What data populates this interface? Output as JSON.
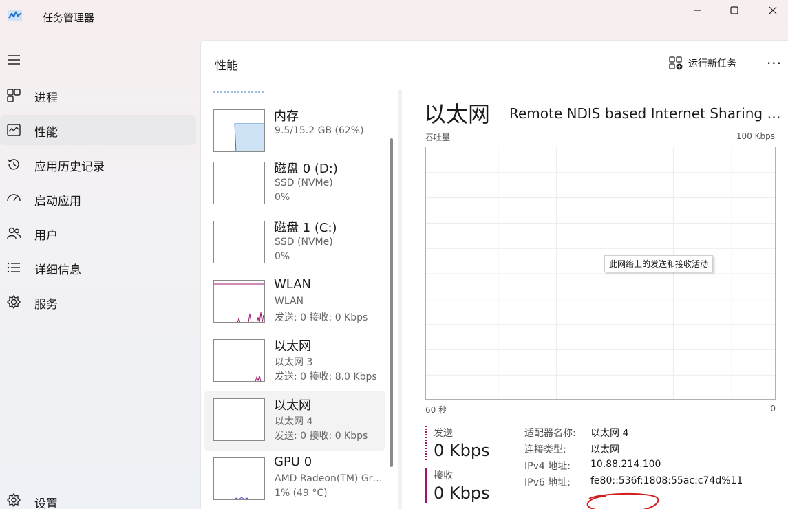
{
  "window": {
    "title": "任务管理器"
  },
  "sidebar": {
    "items": [
      {
        "label": "进程",
        "icon": "processes-icon"
      },
      {
        "label": "性能",
        "icon": "performance-icon",
        "active": true
      },
      {
        "label": "应用历史记录",
        "icon": "app-history-icon"
      },
      {
        "label": "启动应用",
        "icon": "startup-apps-icon"
      },
      {
        "label": "用户",
        "icon": "users-icon"
      },
      {
        "label": "详细信息",
        "icon": "details-icon"
      },
      {
        "label": "服务",
        "icon": "services-icon"
      }
    ],
    "settings_label": "设置"
  },
  "header": {
    "title": "性能",
    "run_task_label": "运行新任务",
    "more_label": "···"
  },
  "devices": [
    {
      "name": "内存",
      "sub1": "9.5/15.2 GB (62%)",
      "sub2": ""
    },
    {
      "name": "磁盘 0 (D:)",
      "sub1": "SSD (NVMe)",
      "sub2": "0%"
    },
    {
      "name": "磁盘 1 (C:)",
      "sub1": "SSD (NVMe)",
      "sub2": "0%"
    },
    {
      "name": "WLAN",
      "sub1": "WLAN",
      "sub2": "发送: 0 接收: 0 Kbps"
    },
    {
      "name": "以太网",
      "sub1": "以太网 3",
      "sub2": "发送: 0 接收: 8.0 Kbps"
    },
    {
      "name": "以太网",
      "sub1": "以太网 4",
      "sub2": "发送: 0 接收: 0 Kbps",
      "active": true
    },
    {
      "name": "GPU 0",
      "sub1": "AMD Radeon(TM) Graphics",
      "sub2": "1% (49 °C)"
    }
  ],
  "detail": {
    "title": "以太网",
    "adapter": "Remote NDIS based Internet Sharing Device",
    "graph_label_left": "吞吐量",
    "graph_label_right": "100 Kbps",
    "tooltip": "此网络上的发送和接收活动",
    "axis_left": "60 秒",
    "axis_right": "0",
    "send_label": "发送",
    "send_value": "0 Kbps",
    "recv_label": "接收",
    "recv_value": "0 Kbps",
    "props": [
      {
        "key": "适配器名称:",
        "value": "以太网 4"
      },
      {
        "key": "连接类型:",
        "value": "以太网"
      },
      {
        "key": "IPv4 地址:",
        "value": "10.88.214.100"
      },
      {
        "key": "IPv6 地址:",
        "value": "fe80::536f:1808:55ac:c74d%11"
      }
    ]
  },
  "colors": {
    "accent_network": "#a0166a",
    "memory_fill": "#cfe3f7",
    "memory_line": "#3a78c4",
    "annotation": "#d21c1c"
  }
}
